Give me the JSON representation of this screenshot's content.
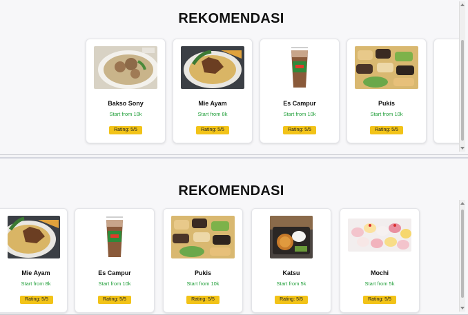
{
  "colors": {
    "price_green": "#1f9e38",
    "rating_yellow": "#f2c318"
  },
  "top": {
    "title": "REKOMENDASI",
    "cards": [
      {
        "name": "Bakso Sony",
        "price": "Start from 10k",
        "rating": "Rating: 5/5",
        "image": "bakso-photo"
      },
      {
        "name": "Mie Ayam",
        "price": "Start from 8k",
        "rating": "Rating: 5/5",
        "image": "mie-ayam-photo"
      },
      {
        "name": "Es Campur",
        "price": "Start from 10k",
        "rating": "Rating: 5/5",
        "image": "es-campur-photo"
      },
      {
        "name": "Pukis",
        "price": "Start from 10k",
        "rating": "Rating: 5/5",
        "image": "pukis-photo"
      }
    ]
  },
  "bottom": {
    "title": "REKOMENDASI",
    "cards": [
      {
        "name": "Mie Ayam",
        "price": "Start from 8k",
        "rating": "Rating: 5/5",
        "image": "mie-ayam-photo"
      },
      {
        "name": "Es Campur",
        "price": "Start from 10k",
        "rating": "Rating: 5/5",
        "image": "es-campur-photo"
      },
      {
        "name": "Pukis",
        "price": "Start from 10k",
        "rating": "Rating: 5/5",
        "image": "pukis-photo"
      },
      {
        "name": "Katsu",
        "price": "Start from 5k",
        "rating": "Rating: 5/5",
        "image": "katsu-photo"
      },
      {
        "name": "Mochi",
        "price": "Start from 5k",
        "rating": "Rating: 5/5",
        "image": "mochi-photo"
      }
    ]
  }
}
